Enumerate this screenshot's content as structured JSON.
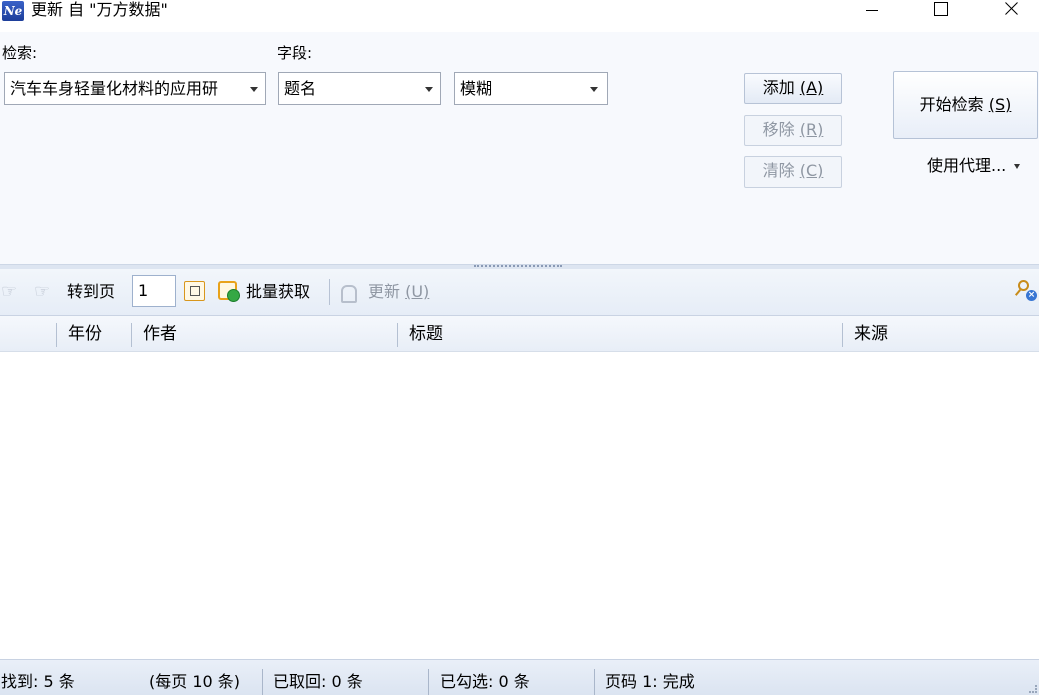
{
  "window": {
    "icon_text": "Ne",
    "title": "更新 自 \"万方数据\""
  },
  "search": {
    "query_label": "检索:",
    "field_label": "字段:",
    "query_value": "汽车车身轻量化材料的应用研",
    "field_value": "题名",
    "match_value": "模糊",
    "add_label": "添加 ",
    "add_key": "(A)",
    "remove_label": "移除 ",
    "remove_key": "(R)",
    "clear_label": "清除 ",
    "clear_key": "(C)",
    "start_label": "开始检索 ",
    "start_key": "(S)",
    "proxy_label": "使用代理..."
  },
  "toolbar": {
    "goto_label": "转到页",
    "page_value": "1",
    "batch_label": "批量获取",
    "update_label": "更新 ",
    "update_key": "(U)"
  },
  "grid": {
    "columns": [
      "年份",
      "作者",
      "标题",
      "来源"
    ]
  },
  "status": {
    "found": "找到: 5 条",
    "per_page": "(每页 10 条)",
    "fetched": "已取回: 0 条",
    "checked": "已勾选: 0 条",
    "page": "页码 1: 完成"
  },
  "icons": {
    "prev": "arrow-left-icon",
    "next": "arrow-right-icon",
    "go": "go-page-icon",
    "batch": "batch-fetch-icon",
    "update": "update-icon",
    "clear_search": "clear-search-icon"
  }
}
